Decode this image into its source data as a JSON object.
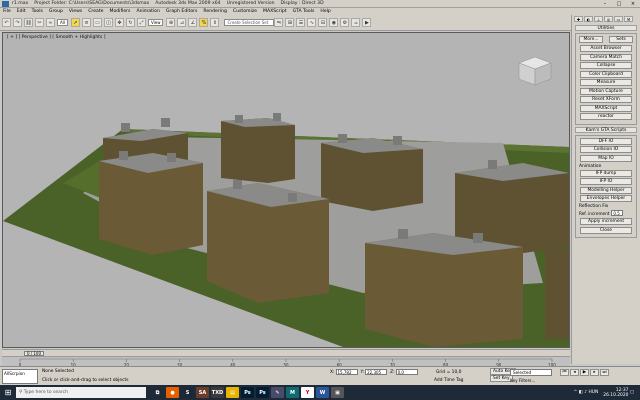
{
  "titlebar": {
    "file": "r1.max",
    "project": "Project Folder: C:\\Users\\SEAG\\Documents\\3dsmax",
    "app": "Autodesk 3ds Max 2009 x64",
    "version": "Unregistered Version",
    "display": "Display : Direct 3D",
    "minimize": "–",
    "maximize": "□",
    "close": "×"
  },
  "menu": [
    "File",
    "Edit",
    "Tools",
    "Group",
    "Views",
    "Create",
    "Modifiers",
    "Animation",
    "Graph Editors",
    "Rendering",
    "Customize",
    "MAXScript",
    "GTA Tools",
    "Help"
  ],
  "toolbar": {
    "filter": "All",
    "refcoord": "View",
    "named_selection": "Create Selection Set",
    "icons": [
      "undo-icon",
      "redo-icon",
      "link-icon",
      "unlink-icon",
      "bind-icon",
      "select-icon",
      "select-by-name-icon",
      "rect-region-icon",
      "window-crossing-icon",
      "move-icon",
      "rotate-icon",
      "scale-icon",
      "pivot-icon",
      "snap-icon",
      "angle-snap-icon",
      "percent-snap-icon",
      "spinner-snap-icon",
      "mirror-icon",
      "align-icon",
      "layer-icon",
      "curve-editor-icon",
      "schematic-icon",
      "material-icon",
      "render-setup-icon",
      "render-icon",
      "quick-render-icon"
    ]
  },
  "viewport": {
    "label": "[ + ] [ Perspective ] [ Smooth + Highlights ]",
    "bg": "#b4b4b4",
    "grass": "#4a6128",
    "pavement": "#9e9e9c",
    "wall": "#5e5232",
    "roof": "#8a8a88"
  },
  "command_panel": {
    "tabs": [
      "create-icon",
      "modify-icon",
      "hierarchy-icon",
      "motion-icon",
      "display-icon",
      "utilities-icon"
    ],
    "utilities_header": "Utilities",
    "more": "More...",
    "sets": "Sets",
    "utilities": [
      "Asset Browser",
      "Camera Match",
      "Collapse",
      "Color Clipboard",
      "Measure",
      "Motion Capture",
      "Reset XForm",
      "MAXScript",
      "reactor"
    ],
    "kams_header": "Kam's GTA Scripts",
    "kams_buttons": [
      "DFF IO",
      "Collision IO",
      "Map IO"
    ],
    "animation_label": "Animation",
    "animation_buttons": [
      "IFP dump",
      "IFP IO"
    ],
    "tools_buttons": [
      "Modelling Helper",
      "Envelopes Helper"
    ],
    "reflection_label": "Reflection Fix",
    "increment_label": "Ref. increment",
    "increment_value": "0.5",
    "apply": "Apply increment",
    "close": "Close"
  },
  "timeline": {
    "frame": "0 / 100",
    "ticks": [
      "0",
      "10",
      "20",
      "30",
      "40",
      "50",
      "60",
      "70",
      "80",
      "90",
      "100"
    ]
  },
  "statusbar": {
    "script": "AllScrpion",
    "status": "None Selected",
    "prompt": "Click or click-and-drag to select objects",
    "x_label": "X:",
    "x_value": "15,782",
    "y_label": "Y:",
    "y_value": "22,305",
    "z_label": "Z:",
    "z_value": "0,0",
    "grid": "Grid = 10,0",
    "add_time_tag": "Add Time Tag",
    "auto_key": "Auto Key",
    "set_key": "Set Key",
    "selected": "Selected",
    "key_filters": "Key Filters..."
  },
  "taskbar": {
    "search_placeholder": "Type here to search",
    "apps": [
      {
        "name": "task-view-icon",
        "label": "⧉",
        "color": "#1e2a38"
      },
      {
        "name": "firefox-icon",
        "label": "●",
        "color": "#e66000"
      },
      {
        "name": "steam-icon",
        "label": "S",
        "color": "#1b2838"
      },
      {
        "name": "gta-sa-icon",
        "label": "SA",
        "color": "#6a3d2a"
      },
      {
        "name": "txd-icon",
        "label": "TXD",
        "color": "#3a3a3a"
      },
      {
        "name": "explorer-icon",
        "label": "▤",
        "color": "#e8b400"
      },
      {
        "name": "photoshop-icon",
        "label": "Ps",
        "color": "#001d34"
      },
      {
        "name": "photoshop-icon-2",
        "label": "Ps",
        "color": "#001d34"
      },
      {
        "name": "notepad-icon",
        "label": "✎",
        "color": "#4a4a6a"
      },
      {
        "name": "3dsmax-icon",
        "label": "M",
        "color": "#0e6b73"
      },
      {
        "name": "yandex-icon",
        "label": "Y",
        "color": "#ffffff"
      },
      {
        "name": "word-icon",
        "label": "W",
        "color": "#2b579a"
      },
      {
        "name": "app-icon",
        "label": "▣",
        "color": "#555555"
      }
    ],
    "lang": "HUN",
    "time": "12:37",
    "date": "26.10.2020"
  }
}
